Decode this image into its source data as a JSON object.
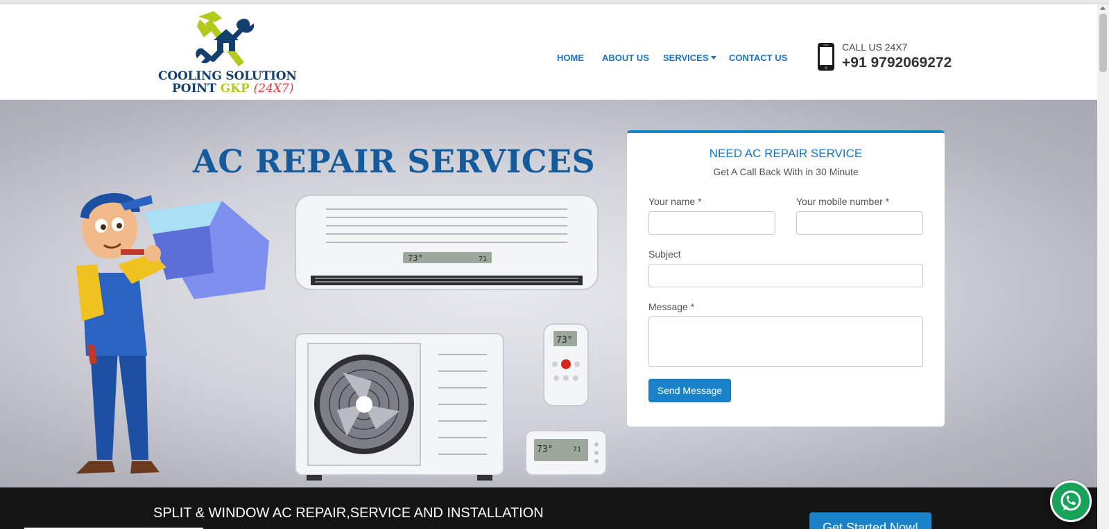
{
  "logo": {
    "line1": "COOLING SOLUTION",
    "line2_prefix": "POINT ",
    "line2_gkp": "GKP",
    "line2_suffix": "(24X7)"
  },
  "nav": {
    "home": "HOME",
    "about": "ABOUT US",
    "services": "SERVICES",
    "contact": "CONTACT US"
  },
  "contact_info": {
    "call_label": "CALL US 24X7",
    "phone": "+91 9792069272"
  },
  "hero": {
    "title": "AC REPAIR SERVICES",
    "display_temp": "73°",
    "display_temp2": "71"
  },
  "form": {
    "title": "NEED AC REPAIR SERVICE",
    "subtitle": "Get A Call Back With in 30 Minute",
    "name_label": "Your name *",
    "name_value": "",
    "mobile_label": "Your mobile number *",
    "mobile_value": "",
    "subject_label": "Subject",
    "subject_value": "",
    "message_label": "Message *",
    "message_value": "",
    "submit_label": "Send Message"
  },
  "bottom": {
    "text": "SPLIT & WINDOW AC REPAIR,SERVICE AND INSTALLATION",
    "cta": "Get Started Now!"
  },
  "icons": {
    "phone": "mobile-phone-icon",
    "whatsapp": "whatsapp-icon"
  },
  "colors": {
    "brand_blue": "#1a82c8",
    "nav_blue": "#1a73c0",
    "title_blue": "#155a9b",
    "logo_navy": "#123f6e",
    "logo_lime": "#b4c91d",
    "whatsapp_green": "#19a35a",
    "bottom_bar": "#141414"
  }
}
